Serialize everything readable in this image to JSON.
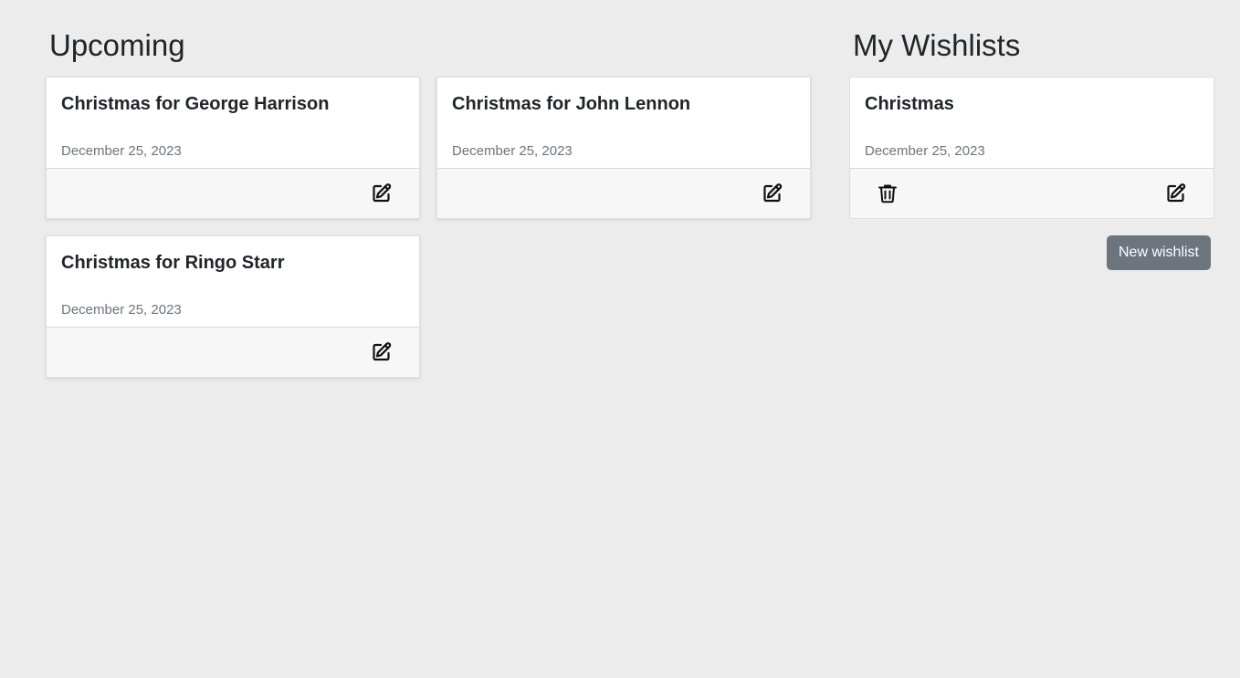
{
  "upcoming": {
    "title": "Upcoming",
    "cards": [
      {
        "title": "Christmas for George Harrison",
        "date": "December 25, 2023",
        "action_icon": "edit-icon"
      },
      {
        "title": "Christmas for John Lennon",
        "date": "December 25, 2023",
        "action_icon": "edit-icon"
      },
      {
        "title": "Christmas for Ringo Starr",
        "date": "December 25, 2023",
        "action_icon": "edit-icon"
      }
    ]
  },
  "my_wishlists": {
    "title": "My Wishlists",
    "cards": [
      {
        "title": "Christmas",
        "date": "December 25, 2023",
        "action_icons": [
          "trash-icon",
          "edit-icon"
        ]
      }
    ],
    "new_button_label": "New wishlist"
  },
  "colors": {
    "background": "#ececec",
    "card": "#ffffff",
    "card_footer": "#f7f7f7",
    "secondary_button": "#6c757d",
    "muted_text": "#6c757d"
  }
}
